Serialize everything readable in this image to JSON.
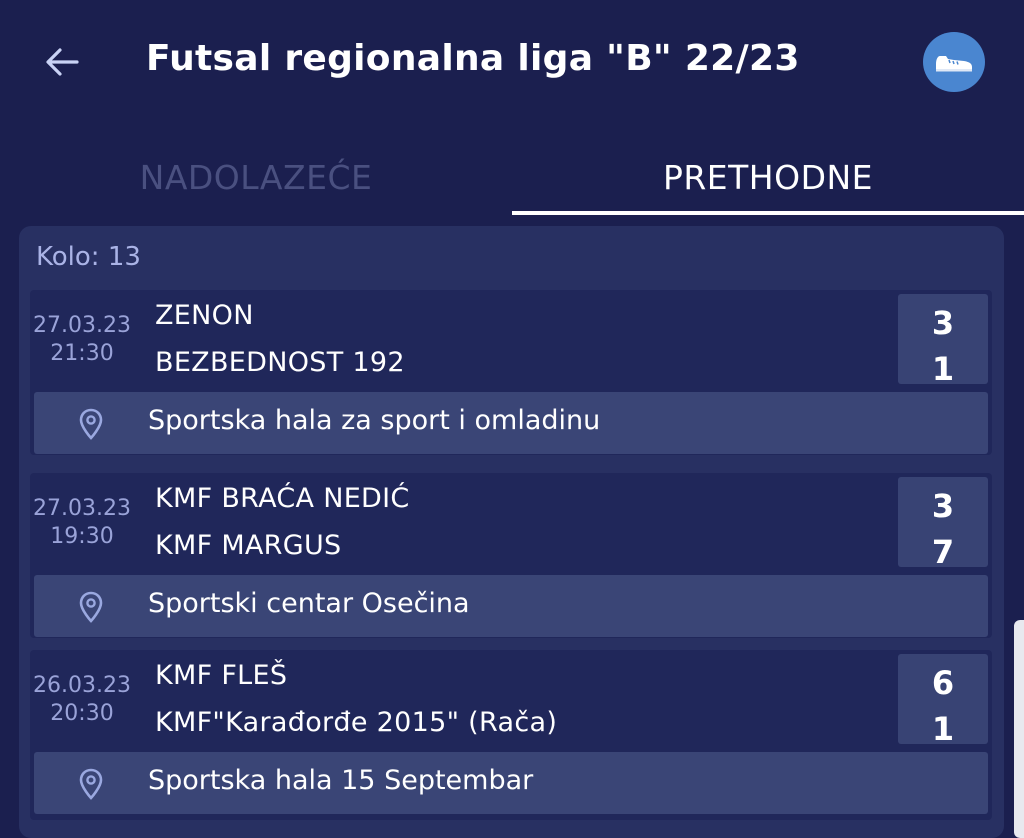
{
  "header": {
    "title": "Futsal regionalna liga \"B\" 22/23",
    "back_icon": "arrow-left-icon",
    "sport_icon": "shoe-icon"
  },
  "tabs": [
    {
      "label": "NADOLAZEĆE",
      "active": false
    },
    {
      "label": "PRETHODNE",
      "active": true
    }
  ],
  "round": {
    "label": "Kolo: 13"
  },
  "matches": [
    {
      "date": "27.03.23",
      "time": "21:30",
      "home": "ZENON",
      "away": "BEZBEDNOST 192",
      "home_score": "3",
      "away_score": "1",
      "venue": "Sportska hala za sport i omladinu"
    },
    {
      "date": "27.03.23",
      "time": "19:30",
      "home": "KMF BRAĆA NEDIĆ",
      "away": "KMF MARGUS",
      "home_score": "3",
      "away_score": "7",
      "venue": "Sportski centar Osečina"
    },
    {
      "date": "26.03.23",
      "time": "20:30",
      "home": "KMF FLEŠ",
      "away": "KMF\"Karađorđe 2015\" (Rača)",
      "home_score": "6",
      "away_score": "1",
      "venue": "Sportska hala 15 Septembar"
    }
  ],
  "colors": {
    "background": "#1b1f4f",
    "panel": "#283062",
    "accent": "#4a86d0"
  }
}
